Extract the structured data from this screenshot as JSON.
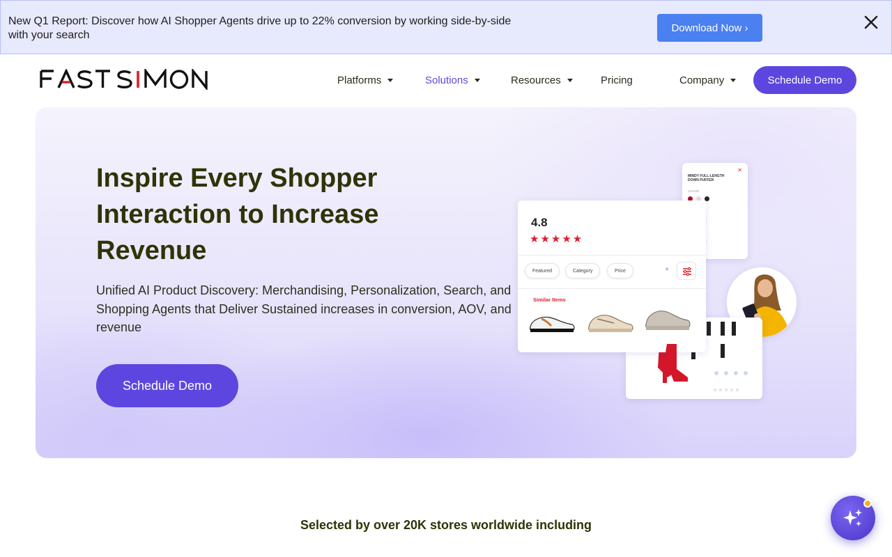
{
  "banner": {
    "text": "New Q1 Report: Discover how AI Shopper Agents drive up to 22% conversion by working side-by-side with your search",
    "button_label": "Download Now ›"
  },
  "header": {
    "logo_text": "FAST SIMON",
    "nav": [
      {
        "label": "Platforms",
        "has_dropdown": true
      },
      {
        "label": "Solutions",
        "has_dropdown": true,
        "active": true
      },
      {
        "label": "Resources",
        "has_dropdown": true
      },
      {
        "label": "Pricing",
        "has_dropdown": false
      },
      {
        "label": "Company",
        "has_dropdown": true
      }
    ],
    "cta_label": "Schedule Demo"
  },
  "hero": {
    "title": "Inspire Every Shopper Interaction to Increase Revenue",
    "subtitle": "Unified AI Product Discovery: Merchandising, Personalization, Search, and Shopping Agents that Deliver Sustained increases in conversion, AOV, and revenue",
    "cta_label": "Schedule Demo"
  },
  "illustration": {
    "detail_title": "MINDY FULL-LENGTH DOWN PUFFER",
    "detail_color_label": "COLOR",
    "rating": "4.8",
    "stars": "★★★★★",
    "chips": [
      "Featured",
      "Category",
      "Price"
    ],
    "similar_label": "Similar Items"
  },
  "social_proof": {
    "tagline": "Selected by over 20K stores worldwide including"
  },
  "colors": {
    "brand_purple": "#5d46e0",
    "banner_bg": "#e7e9fd",
    "banner_button": "#4a80f0",
    "heading": "#2f3306",
    "star_red": "#e01b2a"
  }
}
